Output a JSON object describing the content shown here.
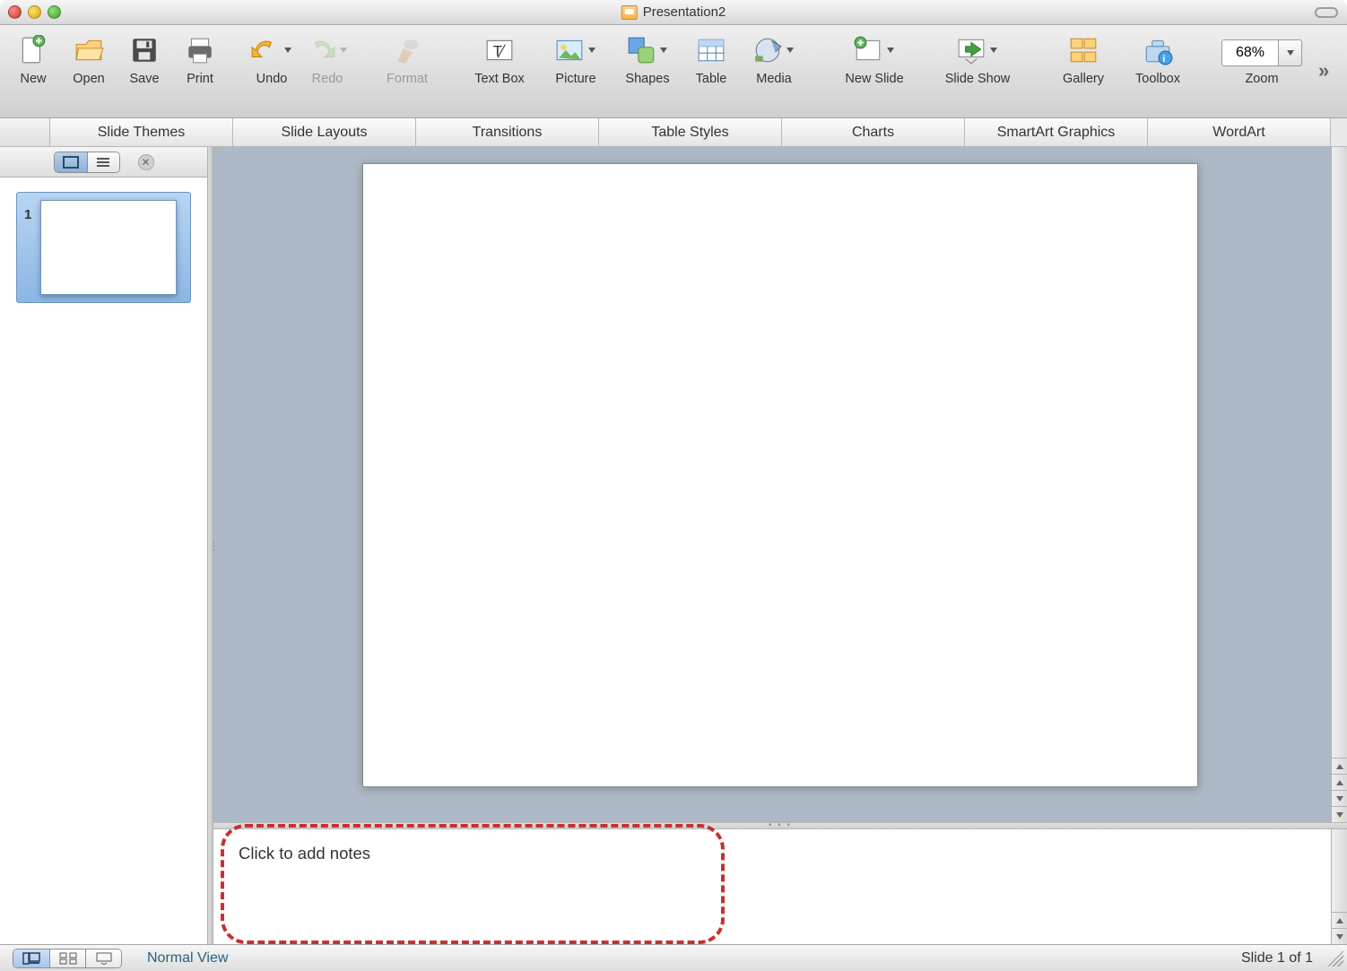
{
  "window": {
    "title": "Presentation2"
  },
  "toolbar": {
    "new": "New",
    "open": "Open",
    "save": "Save",
    "print": "Print",
    "undo": "Undo",
    "redo": "Redo",
    "format": "Format",
    "textbox": "Text Box",
    "picture": "Picture",
    "shapes": "Shapes",
    "table": "Table",
    "media": "Media",
    "newslide": "New Slide",
    "slideshow": "Slide Show",
    "gallery": "Gallery",
    "toolbox": "Toolbox",
    "zoom_label": "Zoom",
    "zoom_value": "68%"
  },
  "ribbon": {
    "tabs": [
      "Slide Themes",
      "Slide Layouts",
      "Transitions",
      "Table Styles",
      "Charts",
      "SmartArt Graphics",
      "WordArt"
    ]
  },
  "sidebar": {
    "slides": [
      {
        "num": "1",
        "selected": true
      }
    ]
  },
  "notes": {
    "placeholder": "Click to add notes"
  },
  "status": {
    "view_name": "Normal View",
    "pager": "Slide 1 of 1"
  }
}
